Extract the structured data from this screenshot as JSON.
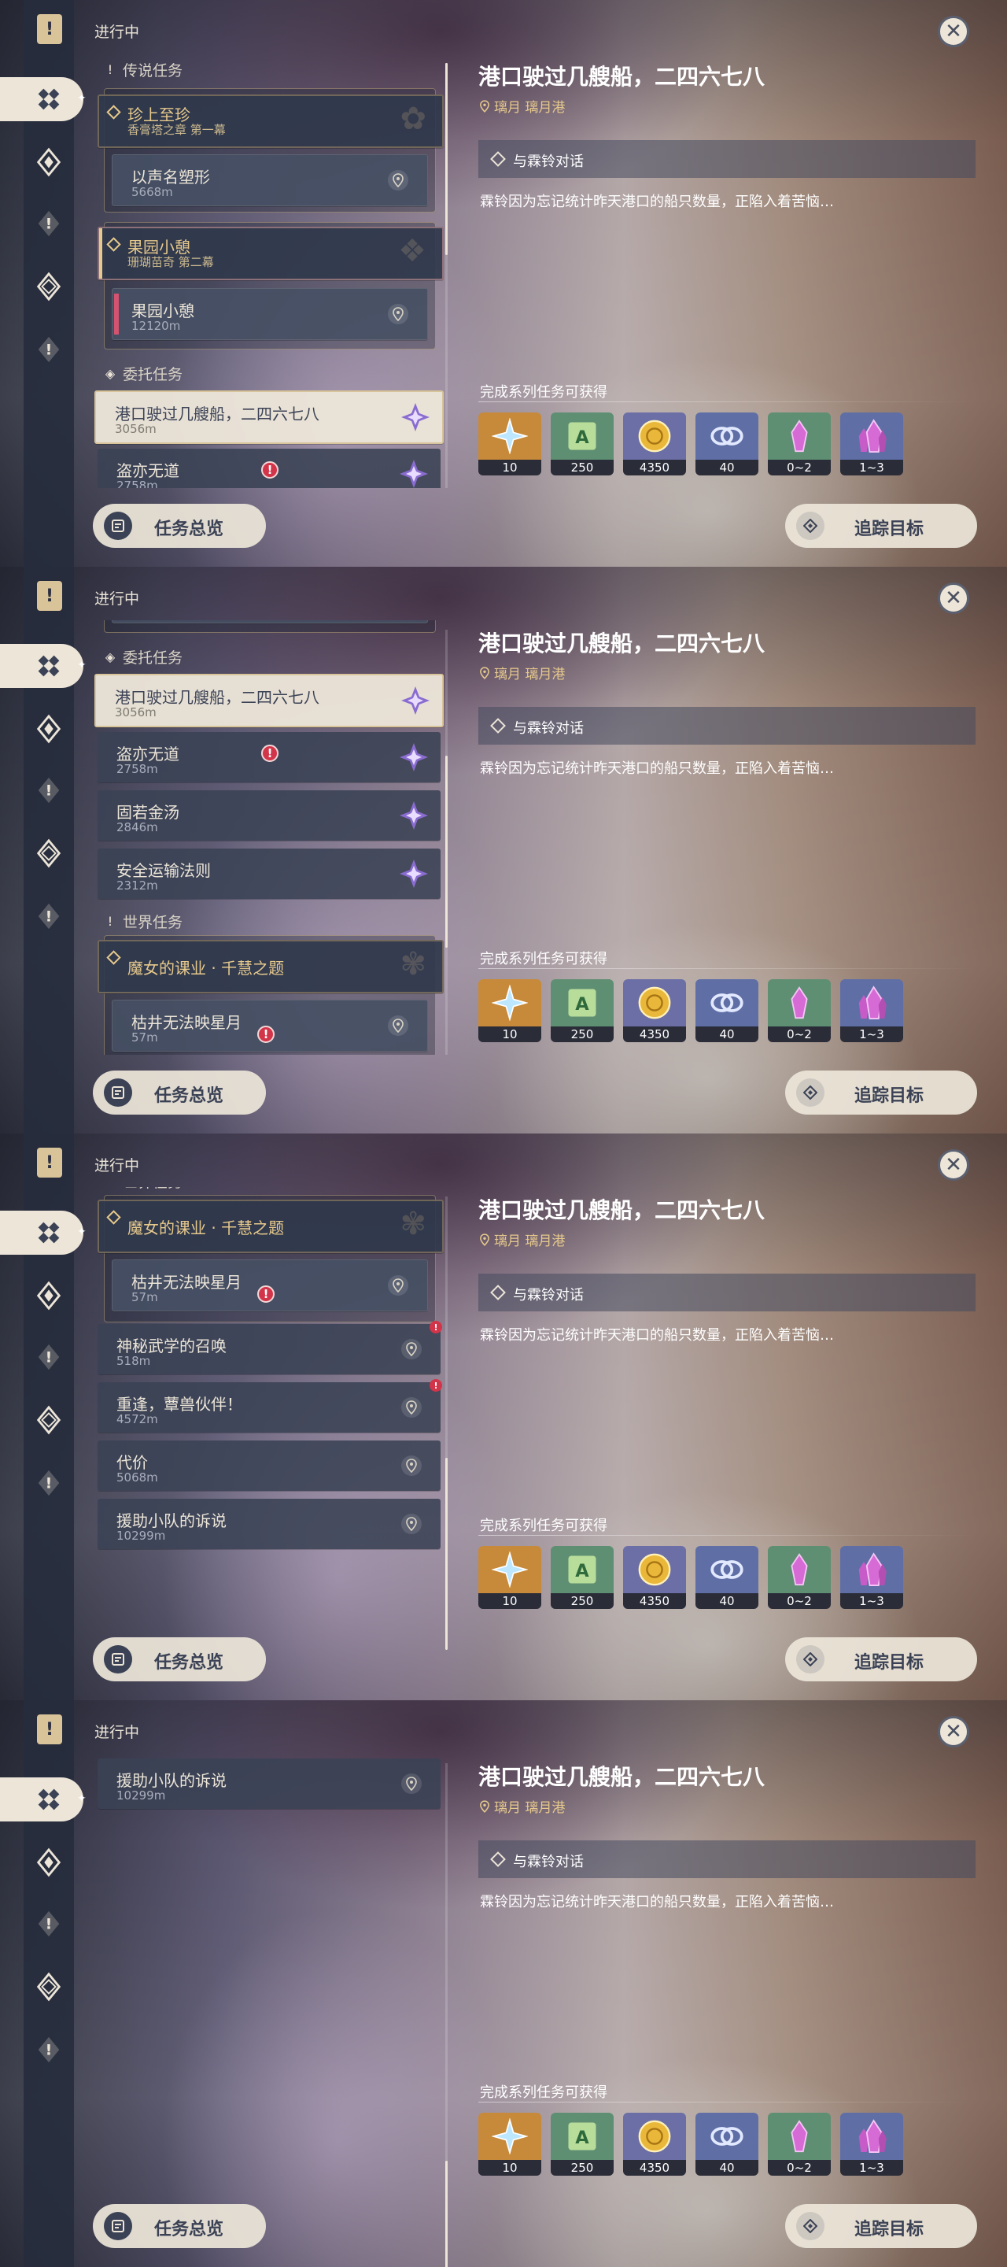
{
  "common": {
    "status_label": "进行中",
    "close_symbol": "✕",
    "quest_title": "港口驶过几艘船，二四六七八",
    "quest_location": "璃月 璃月港",
    "objective": "与霖铃对话",
    "description": "霖铃因为忘记统计昨天港口的船只数量，正陷入着苦恼…",
    "rewards_label": "完成系列任务可获得",
    "rewards": [
      {
        "name": "primogem-icon",
        "count": "10",
        "bg": "#c7893a"
      },
      {
        "name": "adventure-exp-icon",
        "count": "250",
        "bg": "#5f8f73"
      },
      {
        "name": "mora-icon",
        "count": "4350",
        "bg": "#6c6fa6"
      },
      {
        "name": "companionship-exp-icon",
        "count": "40",
        "bg": "#5f6fa6"
      },
      {
        "name": "crystal-small-icon",
        "count": "0~2",
        "bg": "#5f8f73"
      },
      {
        "name": "crystal-large-icon",
        "count": "1~3",
        "bg": "#5f6fa6"
      }
    ],
    "overview_button": "任务总览",
    "track_button": "追踪目标"
  },
  "quests": {
    "legend_header": "传说任务",
    "legend_chapter_1": {
      "title": "珍上至珍",
      "sub": "香膏塔之章 第一幕"
    },
    "legend_step_1": {
      "title": "以声名塑形",
      "dist": "5668m"
    },
    "legend_chapter_2": {
      "title": "果园小憩",
      "sub": "珊瑚苗奇 第二幕"
    },
    "legend_step_2": {
      "title": "果园小憩",
      "dist": "12120m"
    },
    "commission_header": "委托任务",
    "commission_1": {
      "title": "港口驶过几艘船，二四六七八",
      "dist": "3056m"
    },
    "commission_2": {
      "title": "盗亦无道",
      "dist": "2758m"
    },
    "commission_3": {
      "title": "固若金汤",
      "dist": "2846m"
    },
    "commission_4": {
      "title": "安全运输法则",
      "dist": "2312m"
    },
    "world_header": "世界任务",
    "world_chapter": {
      "title": "魔女的课业 · 千慧之题"
    },
    "world_1": {
      "title": "枯井无法映星月",
      "dist": "57m"
    },
    "world_2": {
      "title": "神秘武学的召唤",
      "dist": "518m"
    },
    "world_3": {
      "title": "重逢，蕈兽伙伴！",
      "dist": "4572m"
    },
    "world_4": {
      "title": "代价",
      "dist": "5068m"
    },
    "world_5": {
      "title": "援助小队的诉说",
      "dist": "10299m"
    }
  },
  "frames": [
    {
      "name": "frame-1",
      "scroll": 0
    },
    {
      "name": "frame-2",
      "scroll": 360
    },
    {
      "name": "frame-3",
      "scroll": 750
    },
    {
      "name": "frame-4",
      "scroll": 1140
    }
  ]
}
